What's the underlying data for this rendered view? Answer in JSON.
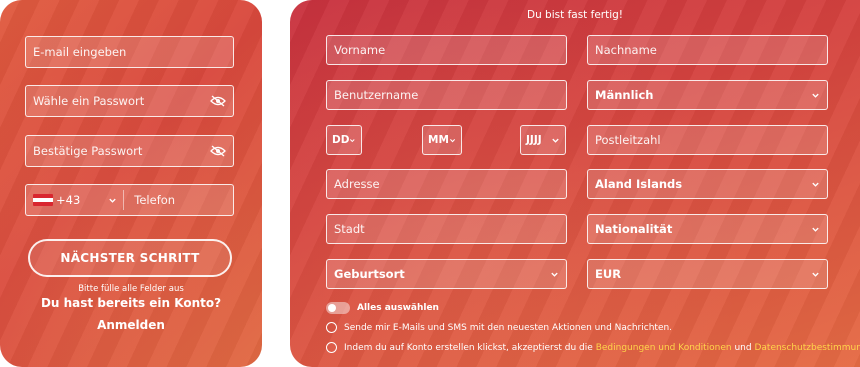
{
  "left_panel": {
    "email_placeholder": "E-mail eingeben",
    "password_placeholder": "Wähle ein Passwort",
    "confirm_password_placeholder": "Bestätige Passwort",
    "phone_code": "+43",
    "phone_placeholder": "Telefon",
    "next_button": "NÄCHSTER SCHRITT",
    "fill_all_fields": "Bitte fülle alle Felder aus",
    "have_account": "Du hast bereits ein Konto?",
    "login_link": "Anmelden"
  },
  "right_panel": {
    "title": "Du bist fast fertig!",
    "first_name_placeholder": "Vorname",
    "last_name_placeholder": "Nachname",
    "username_placeholder": "Benutzername",
    "gender_value": "Männlich",
    "day_value": "DD",
    "month_value": "MM",
    "year_value": "JJJJ",
    "postcode_placeholder": "Postleitzahl",
    "address_placeholder": "Adresse",
    "country_value": "Aland Islands",
    "city_placeholder": "Stadt",
    "nationality_value": "Nationalität",
    "birthplace_value": "Geburtsort",
    "currency_value": "EUR",
    "select_all_label": "Alles auswählen",
    "marketing_consent": "Sende mir E-Mails und SMS mit den neuesten Aktionen und Nachrichten.",
    "terms_prefix": "Indem du auf Konto erstellen klickst, akzeptierst du die",
    "terms_link": "Bedingungen und Konditionen",
    "terms_and": "und",
    "privacy_link": "Datenschutzbestimmungen"
  },
  "colors": {
    "panel_orange": "#e05b3f",
    "panel_red": "#c8323f",
    "link_yellow": "#ffd54a"
  },
  "icons": [
    "eye-off-icon",
    "chevron-down-icon",
    "austria-flag-icon"
  ]
}
